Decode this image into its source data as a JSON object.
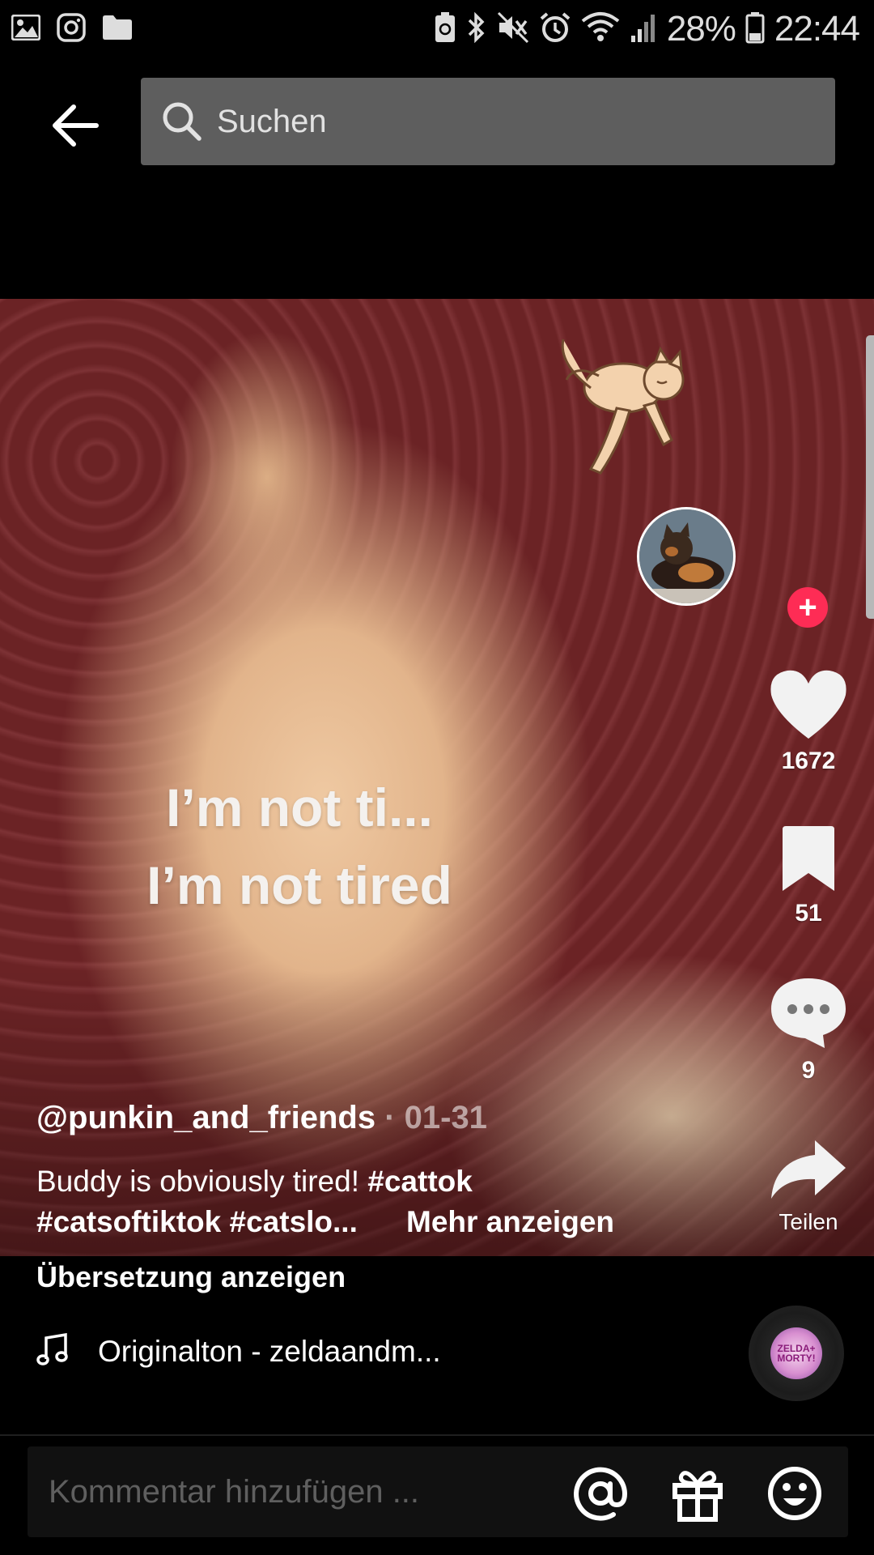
{
  "status_bar": {
    "icons_left": [
      "image-icon",
      "instagram-icon",
      "folder-icon"
    ],
    "icons_right": [
      "battery-saver-icon",
      "bluetooth-icon",
      "mute-icon",
      "alarm-icon",
      "wifi-icon",
      "signal-icon"
    ],
    "battery": "28%",
    "time": "22:44"
  },
  "search": {
    "placeholder": "Suchen"
  },
  "video": {
    "caption_line1": "I’m not ti...",
    "caption_line2": "I’m not tired"
  },
  "actions": {
    "likes": "1672",
    "bookmarks": "51",
    "comments": "9",
    "share_label": "Teilen"
  },
  "post": {
    "username": "@punkin_and_friends",
    "date": "01-31",
    "description_text": "Buddy is obviously tired! ",
    "hashtag1": "#cattok",
    "hashtag2": "#catsoftiktok",
    "hashtag3": "#catslo...",
    "more_label": "Mehr anzeigen",
    "translate_label": "Übersetzung anzeigen",
    "sound": "Originalton - zeldaandm...",
    "disc_label": "ZELDA+ MORTY!"
  },
  "comment_bar": {
    "placeholder": "Kommentar hinzufügen ..."
  },
  "colors": {
    "follow_accent": "#fe2c55",
    "search_bg": "#5e5e5e",
    "background": "#000000"
  }
}
